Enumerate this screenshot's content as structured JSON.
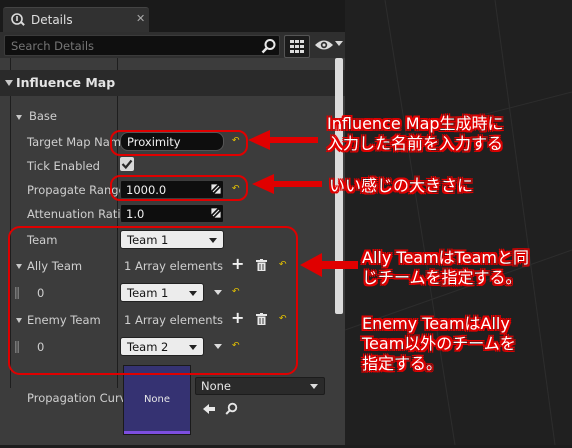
{
  "tab": {
    "title": "Details",
    "close_glyph": "✕",
    "icon": "details-icon"
  },
  "search": {
    "placeholder": "Search Details",
    "value": ""
  },
  "category": {
    "label": "Influence Map"
  },
  "subcategory": {
    "label": "Base"
  },
  "properties": {
    "target_map_name": {
      "label": "Target Map Name",
      "value": "Proximity"
    },
    "tick_enabled": {
      "label": "Tick Enabled",
      "checked": true
    },
    "propagate_range": {
      "label": "Propagate Range",
      "value": "1000.0"
    },
    "attenuation_ratio": {
      "label": "Attenuation Ratio",
      "value": "1.0"
    },
    "team": {
      "label": "Team",
      "value": "Team 1"
    },
    "ally_team": {
      "label": "Ally Team",
      "count": "1 Array elements",
      "index": "0",
      "value": "Team 1"
    },
    "enemy_team": {
      "label": "Enemy Team",
      "count": "1 Array elements",
      "index": "0",
      "value": "Team 2"
    },
    "propagation_curve": {
      "label": "Propagation Curve",
      "thumb_text": "None",
      "value": "None"
    }
  },
  "annotations": {
    "note1_line1": "Influence Map生成時に",
    "note1_line2": "入力した名前を入力する",
    "note2": "いい感じの大きさに",
    "note3_line1": "Ally TeamはTeamと同",
    "note3_line2": "じチームを指定する。",
    "note4_line1": "Enemy TeamはAlly",
    "note4_line2": "Team以外のチームを",
    "note4_line3": "指定する。"
  },
  "colors": {
    "annotation_red": "#e00000",
    "reset_yellow": "#e6c300",
    "curve_purple": "#353272"
  }
}
